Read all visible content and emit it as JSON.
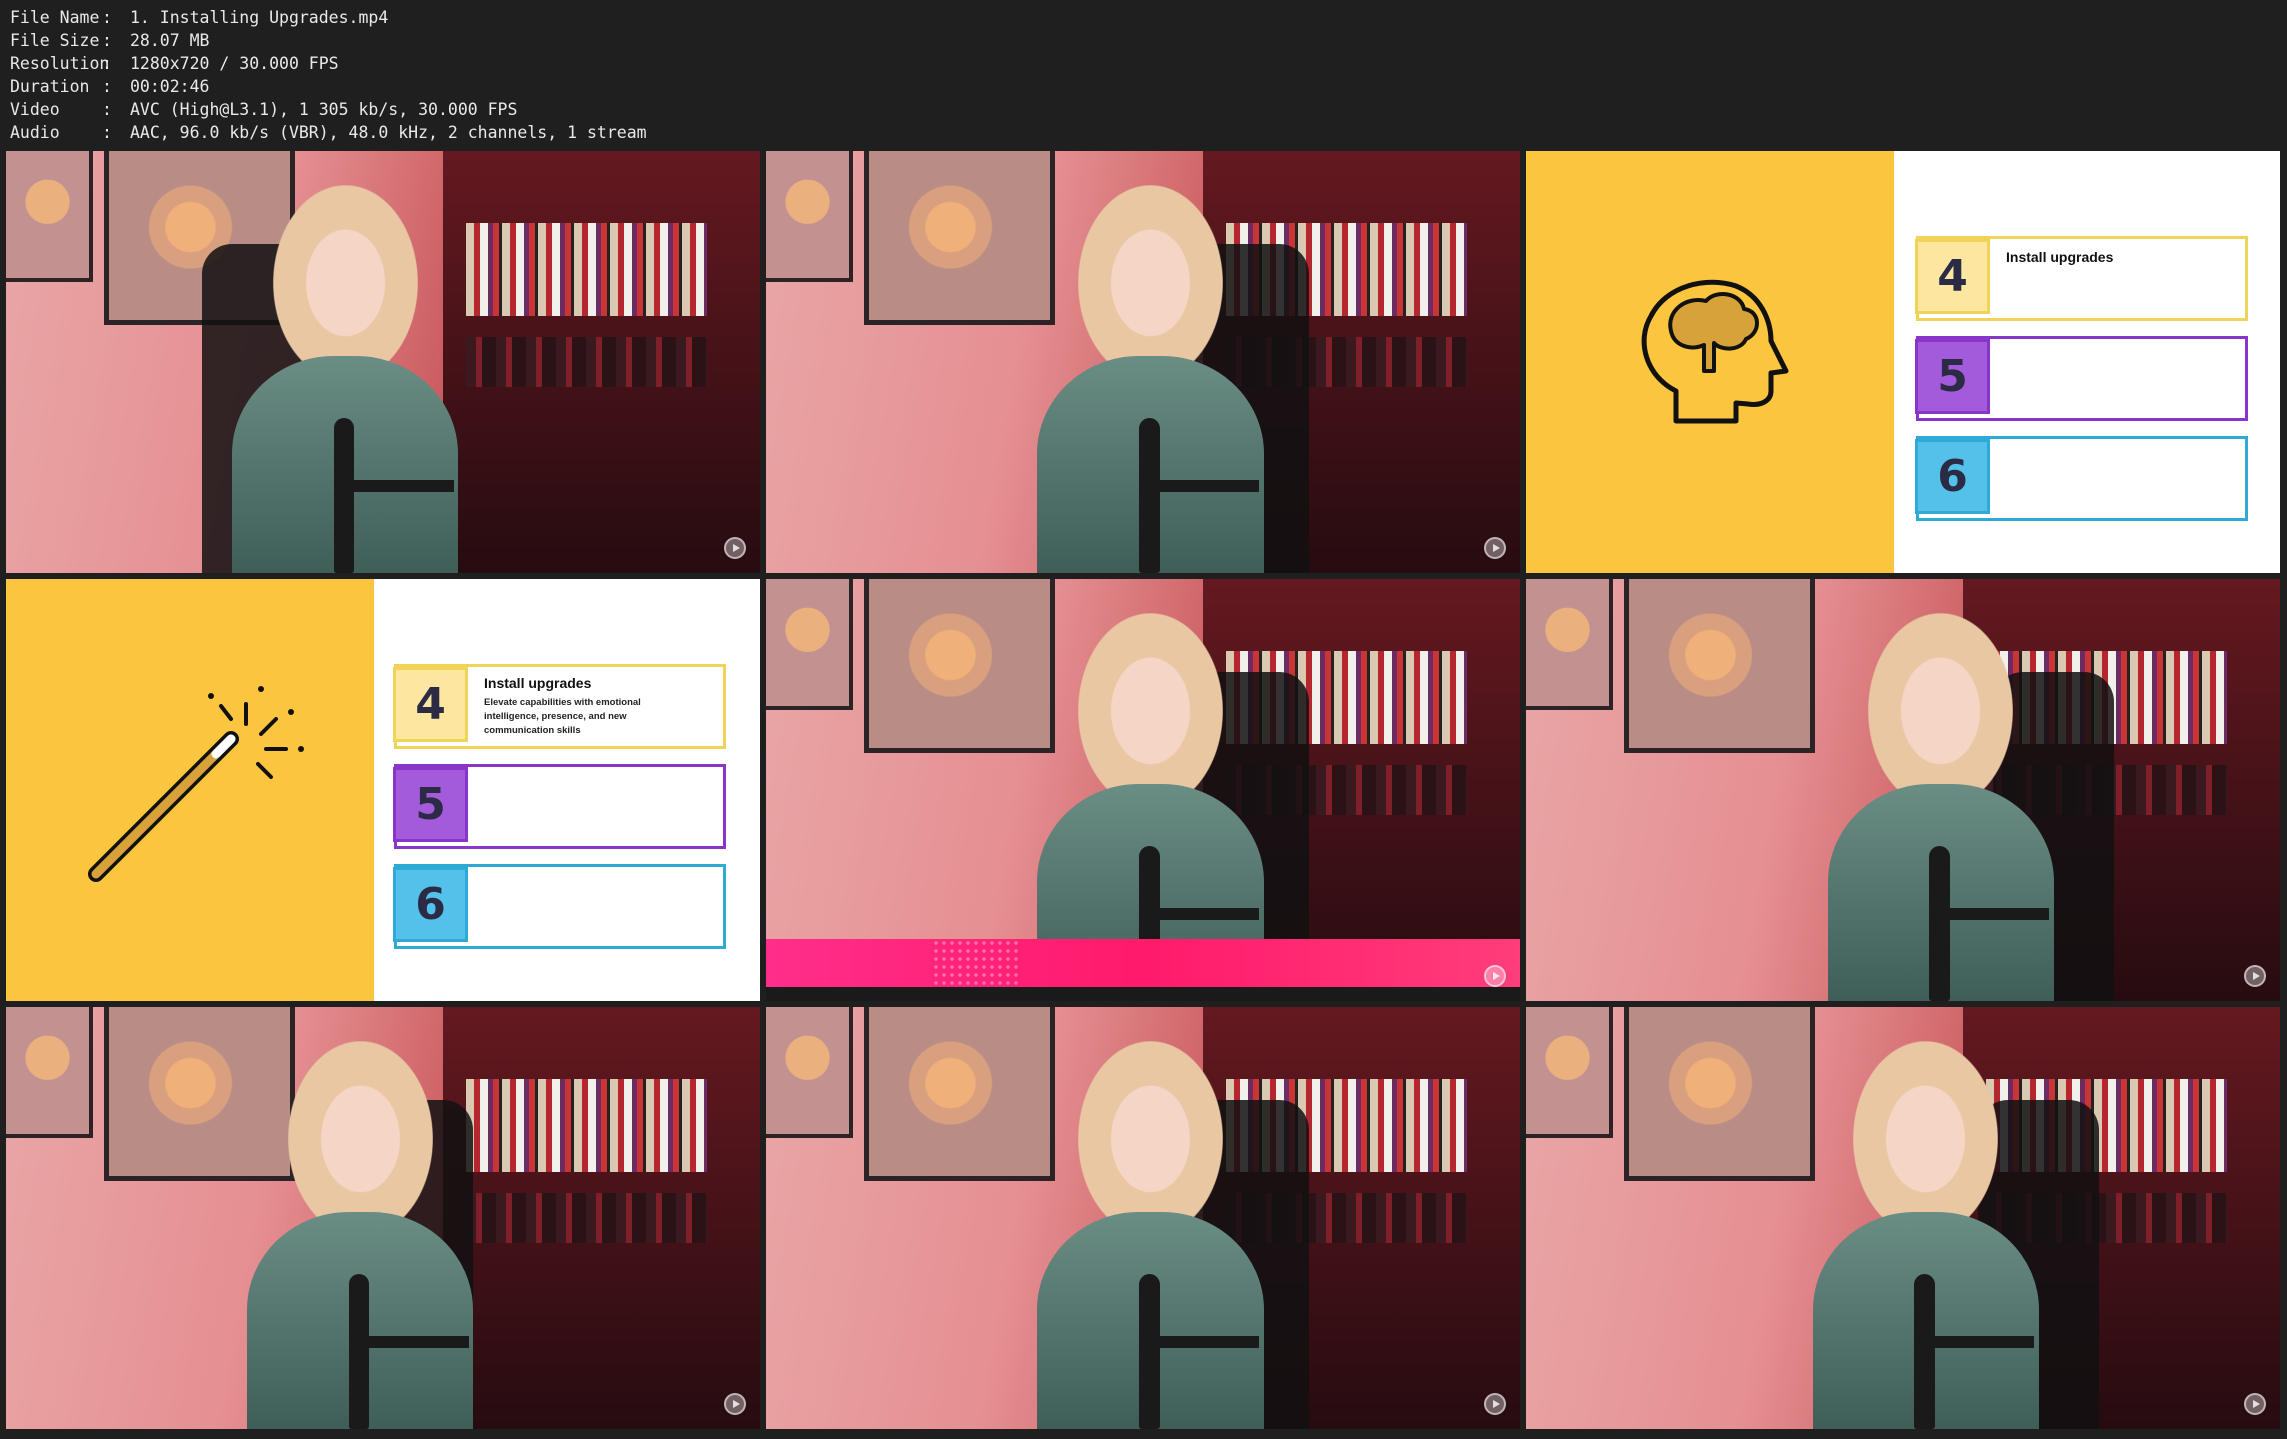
{
  "metadata": {
    "rows": [
      {
        "key": "File Name",
        "value": "1. Installing Upgrades.mp4"
      },
      {
        "key": "File Size",
        "value": "28.07 MB"
      },
      {
        "key": "Resolution",
        "value": "1280x720 / 30.000 FPS"
      },
      {
        "key": "Duration",
        "value": "00:02:46"
      },
      {
        "key": "Video",
        "value": "AVC (High@L3.1), 1 305 kb/s, 30.000 FPS"
      },
      {
        "key": "Audio",
        "value": "AAC, 96.0 kb/s (VBR), 48.0 kHz, 2 channels, 1 stream"
      }
    ],
    "separator": ":"
  },
  "slides": {
    "brain": {
      "icon": "brain-head-icon",
      "cards": [
        {
          "number": "4",
          "title": "Install upgrades",
          "desc": "",
          "color": "#f1d35a",
          "fill": "#fde7a0"
        },
        {
          "number": "5",
          "title": "",
          "desc": "",
          "color": "#8a35c9",
          "fill": "#a35bdc"
        },
        {
          "number": "6",
          "title": "",
          "desc": "",
          "color": "#2fa9d6",
          "fill": "#54c1ea"
        }
      ]
    },
    "wand": {
      "icon": "magic-wand-icon",
      "cards": [
        {
          "number": "4",
          "title": "Install upgrades",
          "desc": "Elevate capabilities with emotional intelligence, presence, and new communication skills",
          "color": "#f1d35a",
          "fill": "#fde7a0"
        },
        {
          "number": "5",
          "title": "",
          "desc": "",
          "color": "#8a35c9",
          "fill": "#a35bdc"
        },
        {
          "number": "6",
          "title": "",
          "desc": "",
          "color": "#2fa9d6",
          "fill": "#54c1ea"
        }
      ]
    }
  },
  "colors": {
    "background": "#1f1f1f",
    "slide_yellow": "#fbc53f",
    "pink_band": "#ff1a6b"
  }
}
